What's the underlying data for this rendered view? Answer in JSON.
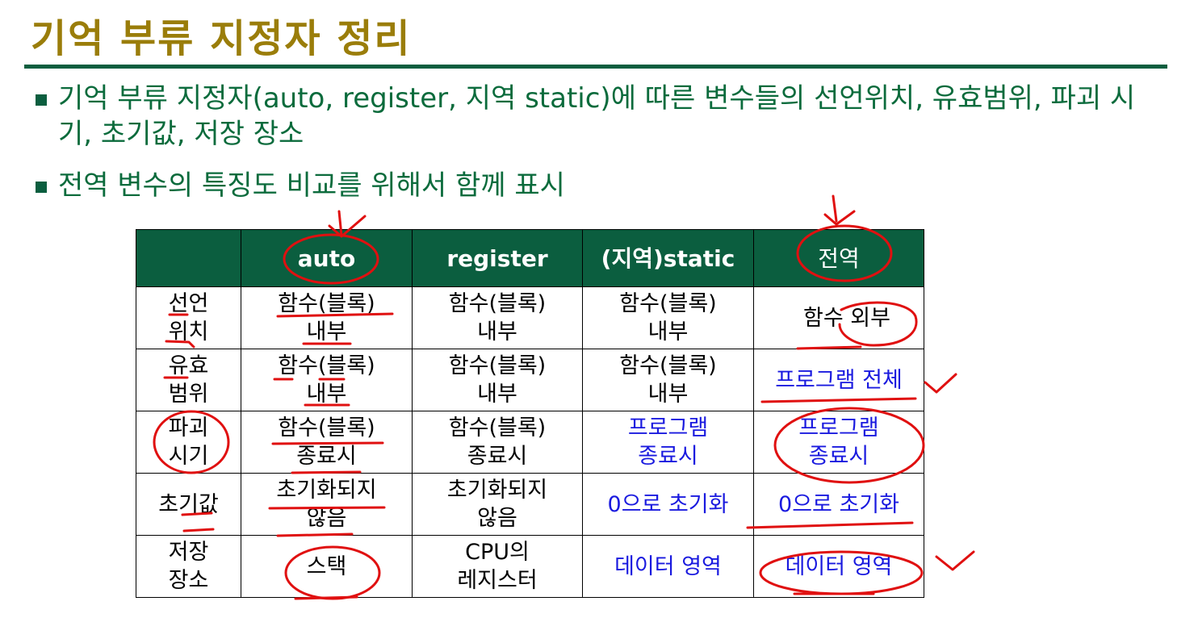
{
  "title": "기억 부류 지정자 정리",
  "bullets": [
    "기억 부류 지정자(auto, register, 지역 static)에 따른 변수들의 선언위치, 유효범위, 파괴 시기, 초기값, 저장 장소",
    "전역 변수의 특징도 비교를 위해서 함께 표시"
  ],
  "table": {
    "headers": [
      "",
      "auto",
      "register",
      "(지역)static",
      "전역"
    ],
    "rows": [
      {
        "label": [
          "선언",
          "위치"
        ],
        "cells": [
          [
            "함수(블록)",
            "내부"
          ],
          [
            "함수(블록)",
            "내부"
          ],
          [
            "함수(블록)",
            "내부"
          ],
          [
            "함수 외부"
          ]
        ]
      },
      {
        "label": [
          "유효",
          "범위"
        ],
        "cells": [
          [
            "함수(블록)",
            "내부"
          ],
          [
            "함수(블록)",
            "내부"
          ],
          [
            "함수(블록)",
            "내부"
          ],
          [
            "프로그램 전체"
          ]
        ]
      },
      {
        "label": [
          "파괴",
          "시기"
        ],
        "cells": [
          [
            "함수(블록)",
            "종료시"
          ],
          [
            "함수(블록)",
            "종료시"
          ],
          [
            "프로그램",
            "종료시"
          ],
          [
            "프로그램",
            "종료시"
          ]
        ]
      },
      {
        "label": [
          "초기값"
        ],
        "cells": [
          [
            "초기화되지",
            "않음"
          ],
          [
            "초기화되지",
            "않음"
          ],
          [
            "0으로 초기화"
          ],
          [
            "0으로 초기화"
          ]
        ]
      },
      {
        "label": [
          "저장",
          "장소"
        ],
        "cells": [
          [
            "스택"
          ],
          [
            "CPU의",
            "레지스터"
          ],
          [
            "데이터 영역"
          ],
          [
            "데이터 영역"
          ]
        ]
      }
    ]
  },
  "colors": {
    "title": "#9a7d0a",
    "accent_green": "#0b5e3f",
    "highlight_blue": "#1a1adf",
    "ink_red": "#e01010"
  }
}
